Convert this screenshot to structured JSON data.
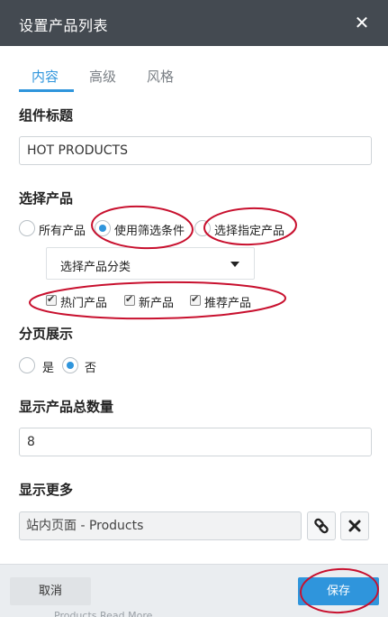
{
  "dialog": {
    "title": "设置产品列表",
    "close_icon": "close-icon"
  },
  "tabs": [
    {
      "label": "内容",
      "active": true
    },
    {
      "label": "高级",
      "active": false
    },
    {
      "label": "风格",
      "active": false
    }
  ],
  "widget_title": {
    "label": "组件标题",
    "value": "HOT PRODUCTS"
  },
  "product_select": {
    "label": "选择产品",
    "options": [
      {
        "label": "所有产品",
        "checked": false
      },
      {
        "label": "使用筛选条件",
        "checked": true
      },
      {
        "label": "选择指定产品",
        "checked": false
      }
    ],
    "category_dropdown": "选择产品分类",
    "filters": [
      {
        "label": "热门产品",
        "checked": true
      },
      {
        "label": "新产品",
        "checked": true
      },
      {
        "label": "推荐产品",
        "checked": true
      }
    ]
  },
  "pagination": {
    "label": "分页展示",
    "options": [
      {
        "label": "是",
        "checked": false
      },
      {
        "label": "否",
        "checked": true
      }
    ]
  },
  "total_count": {
    "label": "显示产品总数量",
    "value": "8"
  },
  "show_more": {
    "label": "显示更多",
    "value": "站内页面 - Products",
    "link_icon": "link-icon",
    "remove_icon": "remove-icon"
  },
  "footer": {
    "cancel_label": "取消",
    "save_label": "保存",
    "partial_text": "Products Read More"
  },
  "colors": {
    "accent": "#2f95dc",
    "titlebar": "#444a51",
    "annotation": "#c8102e"
  }
}
